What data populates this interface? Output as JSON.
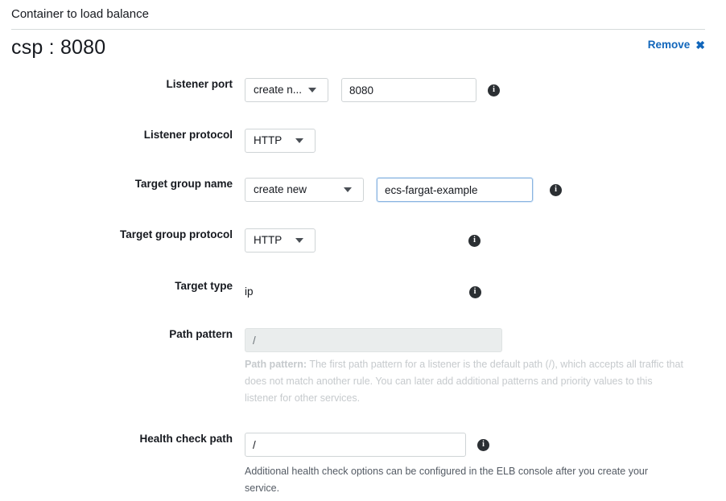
{
  "panel": {
    "title": "Container to load balance",
    "container_name": "csp : 8080",
    "remove_label": "Remove",
    "remove_icon": "close-x-icon"
  },
  "fields": {
    "listener_port": {
      "label": "Listener port",
      "select_value": "create n...",
      "port_value": "8080",
      "info_icon": "info-icon"
    },
    "listener_protocol": {
      "label": "Listener protocol",
      "select_value": "HTTP"
    },
    "target_group_name": {
      "label": "Target group name",
      "select_value": "create new",
      "name_value": "ecs-fargat-example",
      "info_icon": "info-icon"
    },
    "target_group_protocol": {
      "label": "Target group protocol",
      "select_value": "HTTP",
      "info_icon": "info-icon"
    },
    "target_type": {
      "label": "Target type",
      "value": "ip",
      "info_icon": "info-icon"
    },
    "path_pattern": {
      "label": "Path pattern",
      "value": "/",
      "helper_strong": "Path pattern:",
      "helper_text": " The first path pattern for a listener is the default path (/), which accepts all traffic that does not match another rule. You can later add additional patterns and priority values to this listener for other services."
    },
    "health_check_path": {
      "label": "Health check path",
      "value": "/",
      "info_icon": "info-icon",
      "helper_text": "Additional health check options can be configured in the ELB console after you create your service."
    }
  },
  "colors": {
    "link": "#1166bb",
    "focus_border": "#8ab4e0",
    "divider": "#d5dbdb",
    "disabled_bg": "#eaeded"
  }
}
